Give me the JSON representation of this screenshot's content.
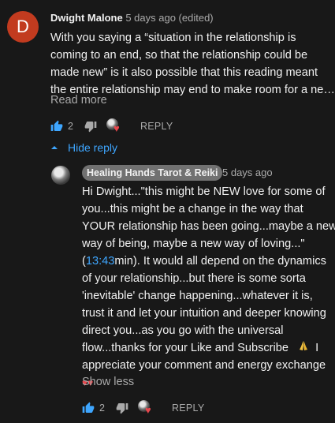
{
  "comment": {
    "avatar_letter": "D",
    "author": "Dwight Malone",
    "meta": "5 days ago (edited)",
    "lines": [
      "With you saying a “situation in the relationship is",
      "coming to an end, so that the relationship could be",
      "made new” is it also possible that this reading meant",
      "the entire relationship may end to make room for a ne…"
    ],
    "read_more": "Read more",
    "like_count": "2",
    "reply_label": "REPLY"
  },
  "hide_reply_label": "Hide reply",
  "reply": {
    "author": "Healing Hands Tarot & Reiki",
    "meta": "5 days ago",
    "lines": {
      "l1": "Hi Dwight...\"this might be NEW love for some of",
      "l2": "you...this might be a change in the way that",
      "l3": "YOUR relationship has been going...maybe a new",
      "l4": "way of being, maybe a new way of loving...\"",
      "l5_open": "(",
      "l5_timestamp": "13:43",
      "l5_rest": "min).  It would all depend on the dynamics",
      "l6": "of your relationship...but there is some sorta",
      "l7": "'inevitable' change happening...whatever it is,",
      "l8": "trust it and let your intuition and deeper knowing",
      "l9": "direct you...as you go with the universal",
      "l10_text": "flow...thanks for your Like and Subscribe",
      "l10_end": "I",
      "l11": "appreciate your comment and energy exchange"
    },
    "show_less": "Show less",
    "like_count": "2",
    "reply_label": "REPLY"
  },
  "colors": {
    "background": "#181818",
    "link": "#3ea6ff",
    "avatar": "#c23b1f",
    "heart": "#e8474d"
  }
}
